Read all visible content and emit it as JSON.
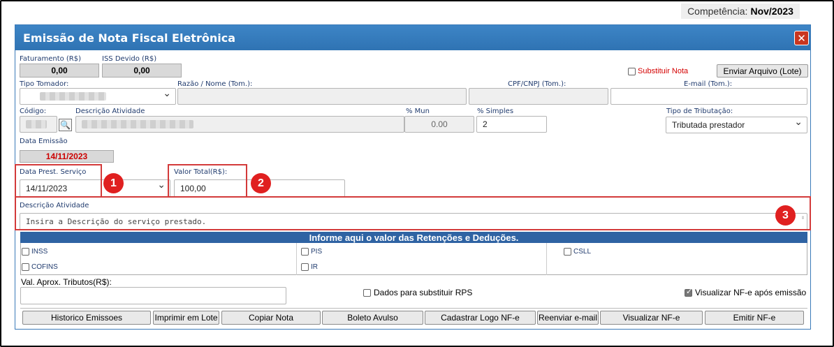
{
  "competencia": {
    "label": "Competência:",
    "value": "Nov/2023"
  },
  "dialog": {
    "title": "Emissão de Nota Fiscal Eletrônica",
    "close_icon": "close-icon"
  },
  "faturamento": {
    "label": "Faturamento (R$)",
    "value": "0,00"
  },
  "iss": {
    "label": "ISS Devido (R$)",
    "value": "0,00"
  },
  "substituir": {
    "label": "Substituir Nota",
    "checked": false
  },
  "enviar_arquivo": {
    "label": "Enviar Arquivo (Lote)"
  },
  "tomador": {
    "tipo_label": "Tipo Tomador:",
    "razao_label": "Razão / Nome (Tom.):",
    "cpf_label": "CPF/CNPJ (Tom.):",
    "email_label": "E-mail (Tom.):"
  },
  "codigo_label": "Código:",
  "descricao_atividade_label": "Descrição Atividade",
  "mun": {
    "label": "% Mun",
    "value": "0.00"
  },
  "simples": {
    "label": "% Simples",
    "value": "2"
  },
  "tipo_tributacao": {
    "label": "Tipo de Tributação:",
    "value": "Tributada prestador"
  },
  "data_emissao": {
    "label": "Data Emissão",
    "value": "14/11/2023"
  },
  "data_prest": {
    "label": "Data Prest. Serviço",
    "value": "14/11/2023"
  },
  "valor_total": {
    "label": "Valor Total(R$):",
    "value": "100,00"
  },
  "descricao": {
    "label": "Descrição Atividade",
    "placeholder": "Insira a Descrição do serviço prestado."
  },
  "markers": [
    "1",
    "2",
    "3"
  ],
  "retencoes": {
    "header": "Informe aqui o valor das Retenções e Deduções.",
    "items": [
      "INSS",
      "PIS",
      "CSLL",
      "COFINS",
      "IR"
    ]
  },
  "val_aprox": {
    "label": "Val. Aprox. Tributos(R$):"
  },
  "dados_rps": {
    "label": "Dados para substituir RPS",
    "checked": false
  },
  "visualizar_apos": {
    "label": "Visualizar NF-e após emissão",
    "checked": true
  },
  "buttons": [
    "Historico Emissoes",
    "Imprimir em Lote",
    "Copiar Nota",
    "Boleto Avulso",
    "Cadastrar Logo NF-e",
    "Reenviar e-mail",
    "Visualizar NF-e",
    "Emitir NF-e"
  ]
}
